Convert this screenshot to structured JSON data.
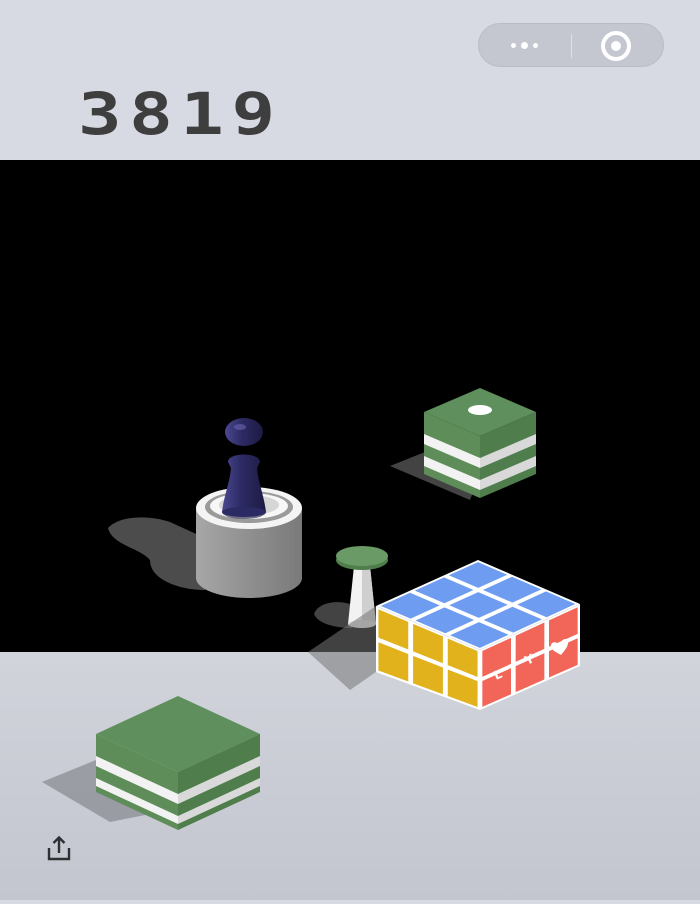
{
  "score": "3819",
  "top_capsule": {
    "more_icon": "three-dots-icon",
    "close_icon": "target-circle-icon"
  },
  "share_icon": "share-upload-icon",
  "cube_face_letters": [
    "L",
    "Y"
  ],
  "cube_face_symbol": "heart-icon",
  "colors": {
    "background": "#d8dae3",
    "black_band": "#000000",
    "score": "#3e3e3e",
    "green": "#5f8f5c",
    "blue": "#6d9cf0",
    "yellow": "#e2b21d",
    "red": "#f2665a",
    "player": "#2f2d6a"
  }
}
